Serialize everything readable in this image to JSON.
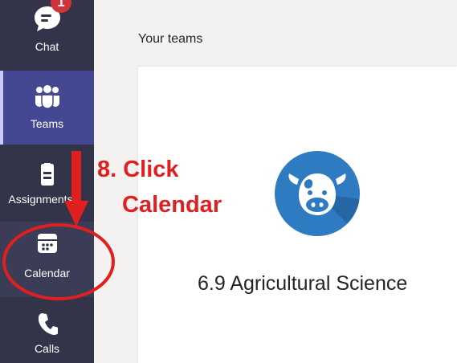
{
  "sidebar": {
    "items": [
      {
        "label": "Chat",
        "icon": "chat-icon",
        "badge": "1"
      },
      {
        "label": "Teams",
        "icon": "teams-icon"
      },
      {
        "label": "Assignments",
        "icon": "assignments-icon"
      },
      {
        "label": "Calendar",
        "icon": "calendar-icon"
      },
      {
        "label": "Calls",
        "icon": "phone-icon"
      }
    ]
  },
  "main": {
    "title": "Your teams",
    "team": {
      "name": "6.9 Agricultural Science",
      "avatar_icon": "cow-icon",
      "avatar_color": "#2e7bc2"
    }
  },
  "annotation": {
    "line1": "8. Click",
    "line2": "Calendar",
    "color": "#e02020"
  },
  "colors": {
    "rail": "#33344a",
    "rail_active": "#444791",
    "badge": "#d13438"
  }
}
